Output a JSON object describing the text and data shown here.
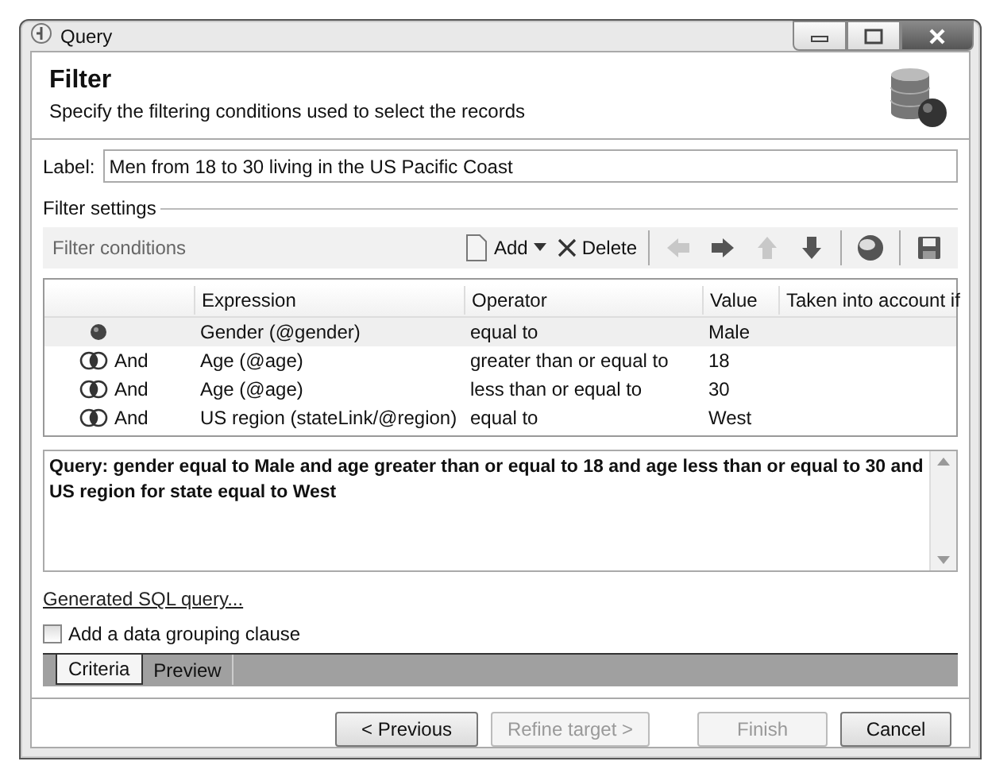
{
  "window": {
    "title": "Query"
  },
  "header": {
    "title": "Filter",
    "subtitle": "Specify the filtering conditions used to select the records"
  },
  "label_field": {
    "label": "Label:",
    "value": "Men from 18 to 30 living in the US Pacific Coast"
  },
  "filter_settings": {
    "title": "Filter settings",
    "toolbar": {
      "title": "Filter conditions",
      "add": "Add",
      "delete": "Delete",
      "tools": [
        {
          "kind": "left",
          "disabled": true
        },
        {
          "kind": "right",
          "disabled": false
        },
        {
          "kind": "up",
          "disabled": true
        },
        {
          "kind": "down",
          "disabled": false
        },
        {
          "kind": "sep"
        },
        {
          "kind": "ball",
          "disabled": false
        },
        {
          "kind": "sep"
        },
        {
          "kind": "save",
          "disabled": false
        }
      ]
    },
    "columns": [
      "Expression",
      "Operator",
      "Value",
      "Taken into account if"
    ],
    "rows": [
      {
        "kind": "root",
        "selected": true,
        "expression": "Gender (@gender)",
        "operator": "equal to",
        "value": "Male"
      },
      {
        "kind": "and",
        "connector": "And",
        "selected": false,
        "expression": "Age (@age)",
        "operator": "greater than or equal to",
        "value": "18"
      },
      {
        "kind": "and",
        "connector": "And",
        "selected": false,
        "expression": "Age (@age)",
        "operator": "less than or equal to",
        "value": "30"
      },
      {
        "kind": "and",
        "connector": "And",
        "selected": false,
        "expression": "US region (stateLink/@region)",
        "operator": "equal to",
        "value": "West"
      }
    ]
  },
  "query_text": "Query: gender equal to Male and age greater than or equal to 18 and age less than or equal to 30 and US region for state equal to West",
  "sql_link": "Generated SQL query...",
  "grouping": {
    "label": "Add a data grouping clause",
    "checked": false
  },
  "tabs": [
    {
      "label": "Criteria",
      "selected": true
    },
    {
      "label": "Preview",
      "selected": false
    }
  ],
  "buttons": [
    {
      "label": "< Previous",
      "disabled": false
    },
    {
      "label": "Refine target >",
      "disabled": true
    },
    {
      "label": "Finish",
      "disabled": true
    },
    {
      "label": "Cancel",
      "disabled": false
    }
  ]
}
